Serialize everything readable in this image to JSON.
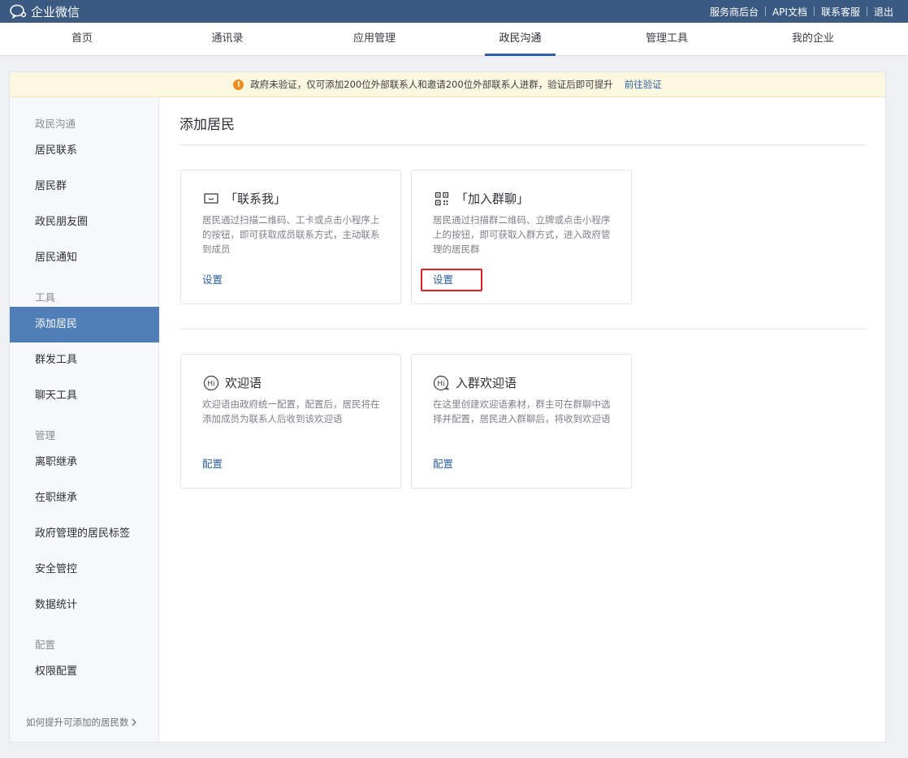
{
  "topbar": {
    "logo_text": "企业微信",
    "links": [
      "服务商后台",
      "API文档",
      "联系客服",
      "退出"
    ]
  },
  "nav": {
    "tabs": [
      "首页",
      "通讯录",
      "应用管理",
      "政民沟通",
      "管理工具",
      "我的企业"
    ],
    "active": "政民沟通"
  },
  "notice": {
    "text": "政府未验证，仅可添加200位外部联系人和邀请200位外部联系人进群，验证后即可提升",
    "link": "前往验证"
  },
  "sidebar": {
    "groups": {
      "g1": "政民沟通",
      "g2": "工具",
      "g3": "管理",
      "g4": "配置"
    },
    "items": {
      "residents": "居民联系",
      "groups": "居民群",
      "moments": "政民朋友圈",
      "notify": "居民通知",
      "add": "添加居民",
      "mass": "群发工具",
      "chat": "聊天工具",
      "resign": "离职继承",
      "onjob": "在职继承",
      "tags": "政府管理的居民标签",
      "security": "安全管控",
      "stats": "数据统计",
      "perm": "权限配置"
    },
    "footer": "如何提升可添加的居民数"
  },
  "main": {
    "title": "添加居民",
    "cards": {
      "contact": {
        "title": "「联系我」",
        "desc": "居民通过扫描二维码、工卡或点击小程序上的按钮，即可获取成员联系方式，主动联系到成员",
        "action": "设置",
        "icon": "chat-bubble-icon"
      },
      "join": {
        "title": "「加入群聊」",
        "desc": "居民通过扫描群二维码、立牌或点击小程序上的按钮，即可获取入群方式，进入政府管理的居民群",
        "action": "设置",
        "icon": "qr-code-icon"
      },
      "welcome": {
        "title": "欢迎语",
        "desc": "欢迎语由政府统一配置，配置后，居民将在添加成员为联系人后收到该欢迎语",
        "action": "配置",
        "icon": "hi-icon"
      },
      "group_welcome": {
        "title": "入群欢迎语",
        "desc": "在这里创建欢迎语素材，群主可在群聊中选择并配置，居民进入群聊后，将收到欢迎语",
        "action": "配置",
        "icon": "hi-bubble-icon"
      }
    }
  },
  "colors": {
    "topbar": "#3b5a82",
    "accent": "#2e61a3",
    "sidebar_active": "#4f7fb6",
    "highlight": "#e02020",
    "notice_bg": "#fcf7e0"
  }
}
